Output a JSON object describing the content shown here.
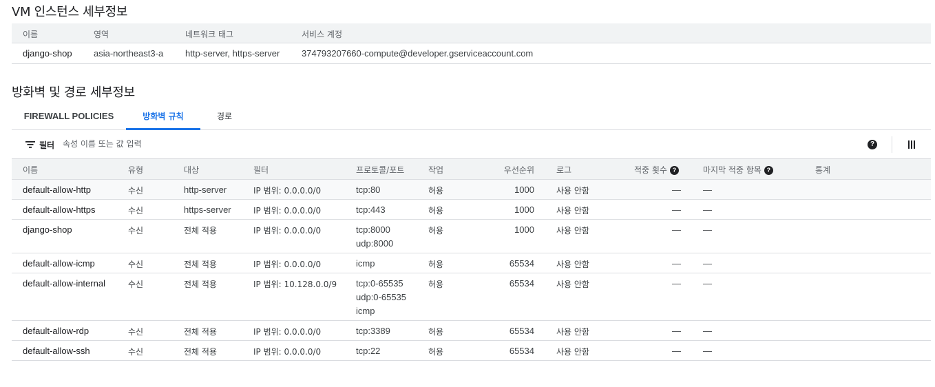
{
  "vm_section": {
    "title": "VM 인스턴스 세부정보",
    "headers": [
      "이름",
      "영역",
      "네트워크 태그",
      "서비스 계정"
    ],
    "row": {
      "name": "django-shop",
      "zone": "asia-northeast3-a",
      "tags": "http-server, https-server",
      "service_account": "374793207660-compute@developer.gserviceaccount.com"
    }
  },
  "firewall_section": {
    "title": "방화벽 및 경로 세부정보",
    "tabs": [
      {
        "label": "FIREWALL POLICIES",
        "active": false
      },
      {
        "label": "방화벽 규칙",
        "active": true
      },
      {
        "label": "경로",
        "active": false
      }
    ],
    "filter": {
      "label": "필터",
      "placeholder": "속성 이름 또는 값 입력"
    },
    "toolbar": {
      "help_icon": "help-circle-icon",
      "columns_icon": "column-display-icon"
    },
    "headers": {
      "name": "이름",
      "type": "유형",
      "target": "대상",
      "filter": "필터",
      "protocol": "프로토콜/포트",
      "action": "작업",
      "priority": "우선순위",
      "log": "로그",
      "hit_count": "적중 횟수",
      "last_hit": "마지막 적중 항목",
      "stats": "통계"
    },
    "rows": [
      {
        "name": "default-allow-http",
        "type": "수신",
        "target": "http-server",
        "filter": "IP 범위: 0.0.0.0/0",
        "protocols": [
          "tcp:80"
        ],
        "action": "허용",
        "priority": "1000",
        "log": "사용 안함",
        "hit_count": "—",
        "last_hit": "—"
      },
      {
        "name": "default-allow-https",
        "type": "수신",
        "target": "https-server",
        "filter": "IP 범위: 0.0.0.0/0",
        "protocols": [
          "tcp:443"
        ],
        "action": "허용",
        "priority": "1000",
        "log": "사용 안함",
        "hit_count": "—",
        "last_hit": "—"
      },
      {
        "name": "django-shop",
        "type": "수신",
        "target": "전체 적용",
        "filter": "IP 범위: 0.0.0.0/0",
        "protocols": [
          "tcp:8000",
          "udp:8000"
        ],
        "action": "허용",
        "priority": "1000",
        "log": "사용 안함",
        "hit_count": "—",
        "last_hit": "—"
      },
      {
        "name": "default-allow-icmp",
        "type": "수신",
        "target": "전체 적용",
        "filter": "IP 범위: 0.0.0.0/0",
        "protocols": [
          "icmp"
        ],
        "action": "허용",
        "priority": "65534",
        "log": "사용 안함",
        "hit_count": "—",
        "last_hit": "—"
      },
      {
        "name": "default-allow-internal",
        "type": "수신",
        "target": "전체 적용",
        "filter": "IP 범위: 10.128.0.0/9",
        "protocols": [
          "tcp:0-65535",
          "udp:0-65535",
          "icmp"
        ],
        "action": "허용",
        "priority": "65534",
        "log": "사용 안함",
        "hit_count": "—",
        "last_hit": "—"
      },
      {
        "name": "default-allow-rdp",
        "type": "수신",
        "target": "전체 적용",
        "filter": "IP 범위: 0.0.0.0/0",
        "protocols": [
          "tcp:3389"
        ],
        "action": "허용",
        "priority": "65534",
        "log": "사용 안함",
        "hit_count": "—",
        "last_hit": "—"
      },
      {
        "name": "default-allow-ssh",
        "type": "수신",
        "target": "전체 적용",
        "filter": "IP 범위: 0.0.0.0/0",
        "protocols": [
          "tcp:22"
        ],
        "action": "허용",
        "priority": "65534",
        "log": "사용 안함",
        "hit_count": "—",
        "last_hit": "—"
      }
    ]
  }
}
